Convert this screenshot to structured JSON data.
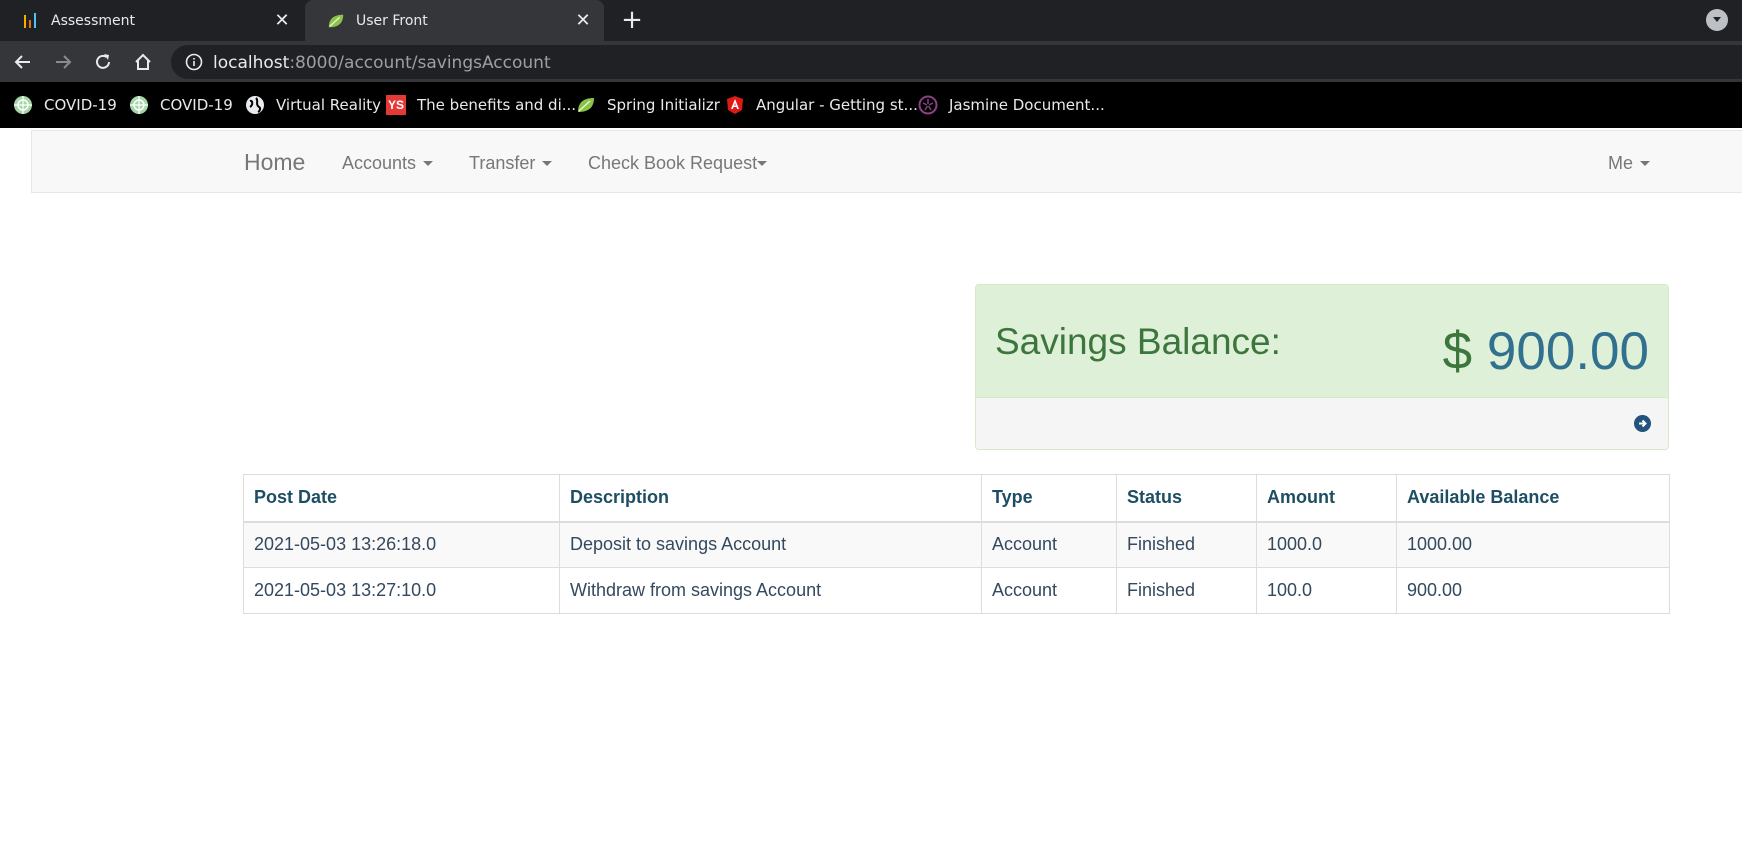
{
  "browser": {
    "tabs": [
      {
        "title": "Assessment",
        "icon": "bar-chart-icon",
        "active": false
      },
      {
        "title": "User Front",
        "icon": "spring-leaf-icon",
        "active": true
      }
    ],
    "url_host": "localhost",
    "url_path": ":8000/account/savingsAccount",
    "bookmarks": [
      {
        "label": "COVID-19",
        "icon": "covid-globe-icon"
      },
      {
        "label": "COVID-19",
        "icon": "covid-globe-icon"
      },
      {
        "label": "Virtual Reality",
        "icon": "globe-icon"
      },
      {
        "label": "The benefits and di...",
        "icon": "ys-icon",
        "badge": "YS"
      },
      {
        "label": "Spring Initializr",
        "icon": "spring-leaf-icon"
      },
      {
        "label": "Angular - Getting st...",
        "icon": "angular-icon"
      },
      {
        "label": "Jasmine Document...",
        "icon": "jasmine-icon"
      }
    ]
  },
  "navbar": {
    "brand": "Home",
    "items": [
      {
        "label": "Accounts"
      },
      {
        "label": "Transfer"
      },
      {
        "label": "Check Book Request"
      }
    ],
    "right_item": "Me"
  },
  "balance": {
    "label": "Savings Balance:",
    "currency": "$",
    "amount": "900.00"
  },
  "table": {
    "headers": [
      "Post Date",
      "Description",
      "Type",
      "Status",
      "Amount",
      "Available Balance"
    ],
    "rows": [
      [
        "2021-05-03 13:26:18.0",
        "Deposit to savings Account",
        "Account",
        "Finished",
        "1000.0",
        "1000.00"
      ],
      [
        "2021-05-03 13:27:10.0",
        "Withdraw from savings Account",
        "Account",
        "Finished",
        "100.0",
        "900.00"
      ]
    ]
  },
  "colors": {
    "success_bg": "#dff0d8",
    "success_text": "#3c763d",
    "info_text": "#31708f"
  }
}
